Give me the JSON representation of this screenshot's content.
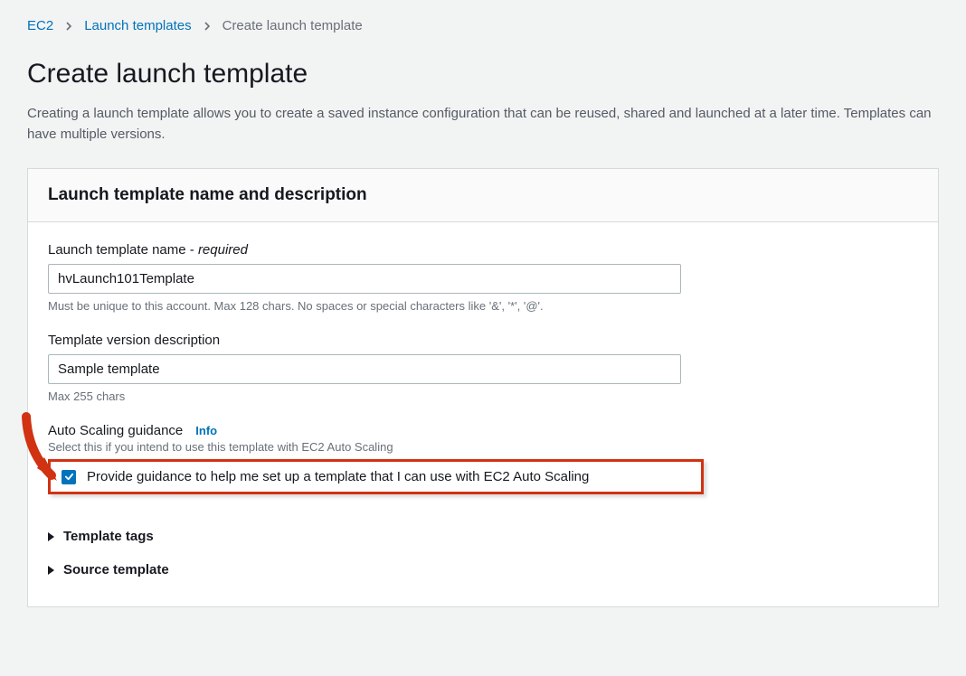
{
  "breadcrumb": {
    "items": [
      "EC2",
      "Launch templates"
    ],
    "current": "Create launch template"
  },
  "page": {
    "title": "Create launch template",
    "description": "Creating a launch template allows you to create a saved instance configuration that can be reused, shared and launched at a later time. Templates can have multiple versions."
  },
  "panel": {
    "heading": "Launch template name and description",
    "name_field": {
      "label_prefix": "Launch template name - ",
      "label_required": "required",
      "value": "hvLaunch101Template",
      "hint": "Must be unique to this account. Max 128 chars. No spaces or special characters like '&', '*', '@'."
    },
    "version_field": {
      "label": "Template version description",
      "value": "Sample template",
      "hint": "Max 255 chars"
    },
    "autoscaling": {
      "label": "Auto Scaling guidance",
      "info": "Info",
      "hint": "Select this if you intend to use this template with EC2 Auto Scaling",
      "checkbox_label": "Provide guidance to help me set up a template that I can use with EC2 Auto Scaling",
      "checked": true
    },
    "expandos": {
      "template_tags": "Template tags",
      "source_template": "Source template"
    }
  }
}
